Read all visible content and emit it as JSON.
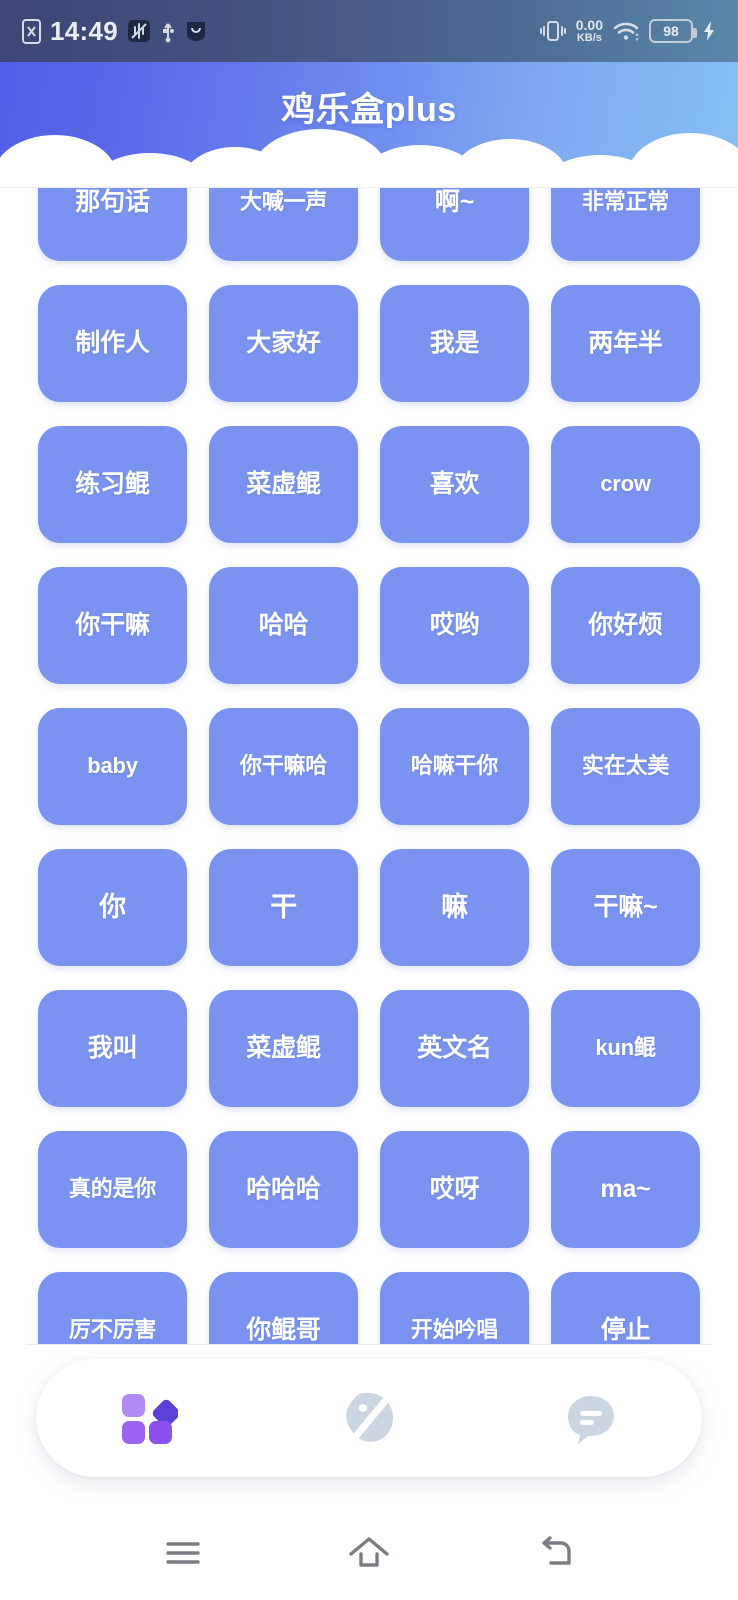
{
  "statusbar": {
    "time": "14:49",
    "sim_icon": "sim-card-off-icon",
    "mute_icon": "vibrate-mute-icon",
    "usb_icon": "usb-icon",
    "app_icon": "app-notification-icon",
    "vibrate_icon": "vibrate-icon",
    "netspeed_value": "0.00",
    "netspeed_unit": "KB/s",
    "wifi_icon": "wifi-icon",
    "battery_level": "98",
    "charging_icon": "charging-bolt-icon"
  },
  "header": {
    "title": "鸡乐盒plus",
    "gradient_start": "#4f5fe6",
    "gradient_end": "#86c0f4",
    "cloud_color": "#ffffff"
  },
  "grid": {
    "button_color": "#7b93f0",
    "button_text_color": "#ffffff",
    "columns": 4,
    "buttons": [
      {
        "label": "那句话"
      },
      {
        "label": "大喊一声"
      },
      {
        "label": "啊~"
      },
      {
        "label": "非常正常"
      },
      {
        "label": "制作人"
      },
      {
        "label": "大家好"
      },
      {
        "label": "我是"
      },
      {
        "label": "两年半"
      },
      {
        "label": "练习鲲"
      },
      {
        "label": "菜虚鲲"
      },
      {
        "label": "喜欢"
      },
      {
        "label": "crow"
      },
      {
        "label": "你干嘛"
      },
      {
        "label": "哈哈"
      },
      {
        "label": "哎哟"
      },
      {
        "label": "你好烦"
      },
      {
        "label": "baby"
      },
      {
        "label": "你干嘛哈"
      },
      {
        "label": "哈嘛干你"
      },
      {
        "label": "实在太美"
      },
      {
        "label": "你"
      },
      {
        "label": "干"
      },
      {
        "label": "嘛"
      },
      {
        "label": "干嘛~"
      },
      {
        "label": "我叫"
      },
      {
        "label": "菜虚鲲"
      },
      {
        "label": "英文名"
      },
      {
        "label": "kun鲲"
      },
      {
        "label": "真的是你"
      },
      {
        "label": "哈哈哈"
      },
      {
        "label": "哎呀"
      },
      {
        "label": "ma~"
      },
      {
        "label": "厉不厉害"
      },
      {
        "label": "你鲲哥"
      },
      {
        "label": "开始吟唱"
      },
      {
        "label": "停止"
      }
    ]
  },
  "tabbar": {
    "active_color": "#8b5cf6",
    "inactive_color": "#ccd4e0",
    "items": [
      {
        "name": "grid",
        "icon": "grid-apps-icon",
        "active": true
      },
      {
        "name": "discover",
        "icon": "planet-discover-icon",
        "active": false
      },
      {
        "name": "messages",
        "icon": "chat-bubble-icon",
        "active": false
      }
    ]
  },
  "androidnav": {
    "color": "#7a7d83",
    "items": [
      {
        "name": "recents",
        "icon": "menu-recents-icon"
      },
      {
        "name": "home",
        "icon": "home-icon"
      },
      {
        "name": "back",
        "icon": "back-arrow-icon"
      }
    ]
  }
}
